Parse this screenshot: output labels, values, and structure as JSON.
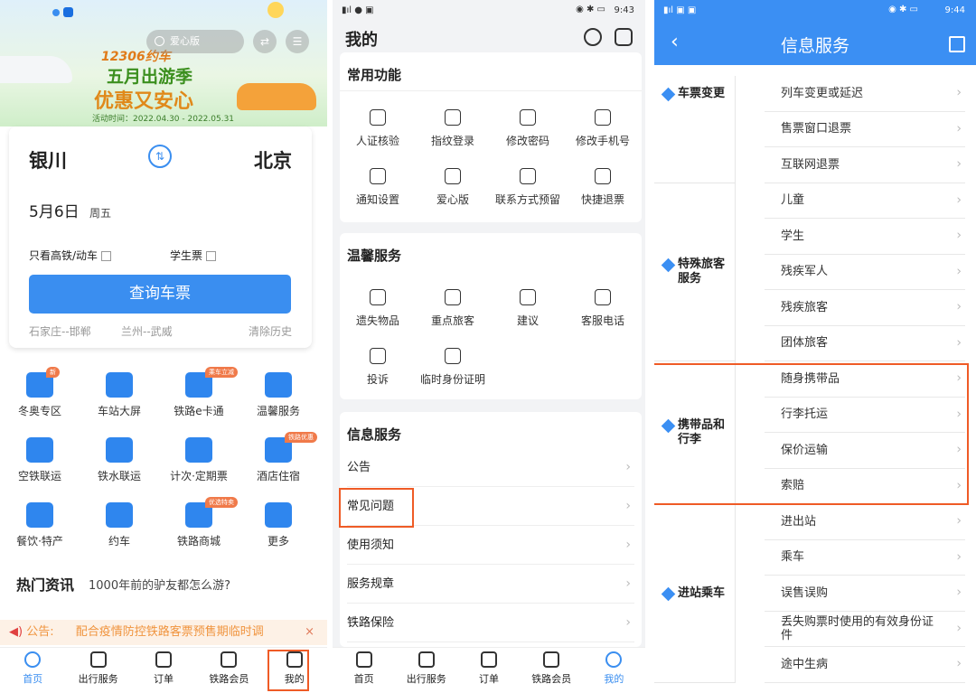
{
  "home": {
    "banner": {
      "brand": "12306约车",
      "headline1": "五月出游季",
      "headline2": "优惠又安心",
      "period": "活动时间：2022.04.30 - 2022.05.31",
      "search_placeholder": "爱心版"
    },
    "from": "银川",
    "to": "北京",
    "date": "5月6日",
    "weekday": "周五",
    "gaotie_label": "只看高铁/动车",
    "student_label": "学生票",
    "query_button": "查询车票",
    "history": [
      "石家庄--邯郸",
      "兰州--武威"
    ],
    "clear_history": "清除历史",
    "grid": [
      {
        "label": "冬奥专区",
        "badge": "新"
      },
      {
        "label": "车站大屏"
      },
      {
        "label": "铁路e卡通",
        "badge": "乘车立减"
      },
      {
        "label": "温馨服务"
      },
      {
        "label": "空铁联运"
      },
      {
        "label": "铁水联运"
      },
      {
        "label": "计次·定期票"
      },
      {
        "label": "酒店住宿",
        "badge": "铁路优惠"
      },
      {
        "label": "餐饮·特产"
      },
      {
        "label": "约车"
      },
      {
        "label": "铁路商城",
        "badge": "优选特卖"
      },
      {
        "label": "更多"
      }
    ],
    "hot_title": "热门资讯",
    "hot_text": "1000年前的驴友都怎么游?",
    "notice_label": "公告:",
    "notice_text": "配合疫情防控铁路客票预售期临时调",
    "notice_close": "×"
  },
  "tabs": [
    "首页",
    "出行服务",
    "订单",
    "铁路会员",
    "我的"
  ],
  "mine": {
    "time": "9:43",
    "title": "我的",
    "common_title": "常用功能",
    "common": [
      "人证核验",
      "指纹登录",
      "修改密码",
      "修改手机号",
      "通知设置",
      "爱心版",
      "联系方式预留",
      "快捷退票"
    ],
    "care_title": "温馨服务",
    "care": [
      "遗失物品",
      "重点旅客",
      "建议",
      "客服电话",
      "投诉",
      "临时身份证明"
    ],
    "info_title": "信息服务",
    "info": [
      "公告",
      "常见问题",
      "使用须知",
      "服务规章",
      "铁路保险"
    ]
  },
  "info": {
    "time": "9:44",
    "title": "信息服务",
    "groups": [
      {
        "name": "车票变更",
        "items": [
          "列车变更或延迟",
          "售票窗口退票",
          "互联网退票"
        ]
      },
      {
        "name": "特殊旅客服务",
        "items": [
          "儿童",
          "学生",
          "残疾军人",
          "残疾旅客",
          "团体旅客"
        ]
      },
      {
        "name": "携带品和行李",
        "items": [
          "随身携带品",
          "行李托运",
          "保价运输",
          "索赔"
        ]
      },
      {
        "name": "进站乘车",
        "items": [
          "进出站",
          "乘车",
          "误售误购",
          "丢失购票时使用的有效身份证件",
          "途中生病"
        ]
      }
    ]
  },
  "colors": {
    "accent": "#3a8ef0",
    "highlight": "#ef5b26"
  }
}
